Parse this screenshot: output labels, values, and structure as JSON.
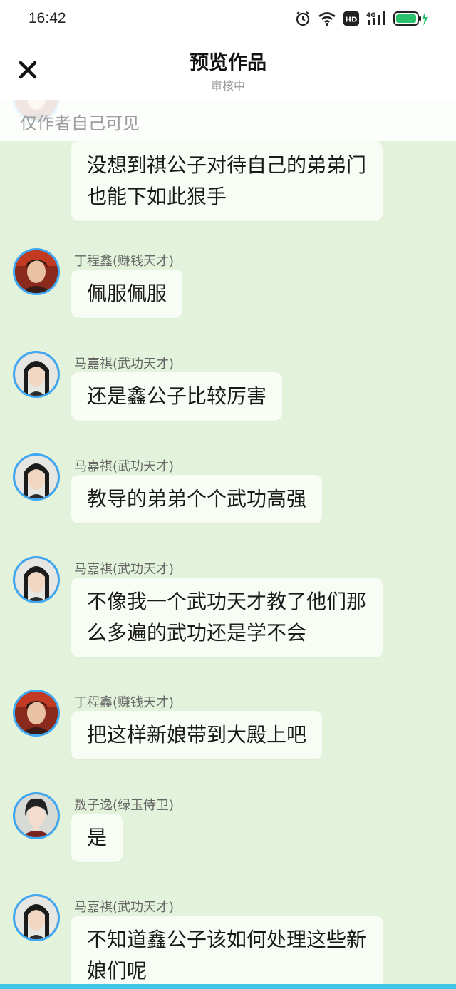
{
  "status_bar": {
    "time": "16:42",
    "icons": [
      "alarm-icon",
      "wifi-icon",
      "hd-icon",
      "signal-4g-icon",
      "battery-charging-icon"
    ],
    "network_label": "4G",
    "hd_label": "HD"
  },
  "header": {
    "title": "预览作品",
    "subtitle": "审核中",
    "close_icon": "close-icon"
  },
  "notice": "仅作者自己可见",
  "colors": {
    "chat_background": "#e3f2da",
    "bubble": "#f7fcf5",
    "avatar_border": "#3ea8f4",
    "bottom_accent": "#3fc6e8"
  },
  "messages": [
    {
      "sender": "",
      "text": "没想到祺公子对待自己的弟弟门也能下如此狠手",
      "avatar": "ding"
    },
    {
      "sender": "丁程鑫(赚钱天才)",
      "text": "佩服佩服",
      "avatar": "ding"
    },
    {
      "sender": "马嘉祺(武功天才)",
      "text": "还是鑫公子比较厉害",
      "avatar": "ma"
    },
    {
      "sender": "马嘉祺(武功天才)",
      "text": "教导的弟弟个个武功高强",
      "avatar": "ma"
    },
    {
      "sender": "马嘉祺(武功天才)",
      "text": "不像我一个武功天才教了他们那么多遍的武功还是学不会",
      "avatar": "ma"
    },
    {
      "sender": "丁程鑫(赚钱天才)",
      "text": "把这样新娘带到大殿上吧",
      "avatar": "ding"
    },
    {
      "sender": "敖子逸(绿玉侍卫)",
      "text": "是",
      "avatar": "ao"
    },
    {
      "sender": "马嘉祺(武功天才)",
      "text": "不知道鑫公子该如何处理这些新娘们呢",
      "avatar": "ma"
    }
  ]
}
